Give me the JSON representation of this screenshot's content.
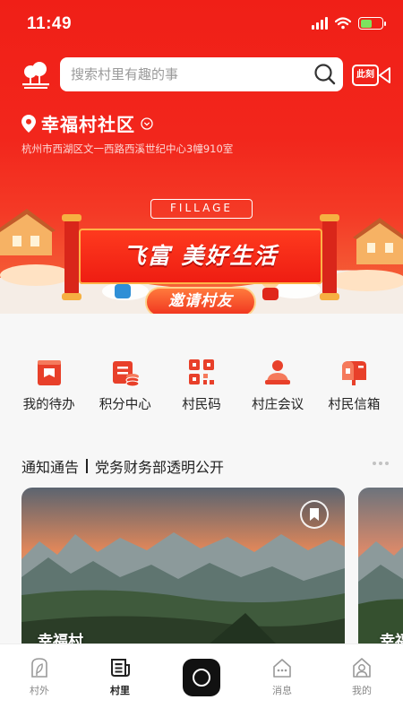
{
  "status_bar": {
    "time": "11:49"
  },
  "search": {
    "placeholder": "搜索村里有趣的事"
  },
  "live": {
    "label": "此刻"
  },
  "community": {
    "name": "幸福村社区",
    "address": "杭州市西湖区文一西路西溪世纪中心3幢910室"
  },
  "banner": {
    "tag": "FILLAGE",
    "slogan": "飞富 美好生活",
    "invite_label": "邀请村友"
  },
  "quick_menu": [
    {
      "label": "我的待办",
      "icon": "inbox-icon"
    },
    {
      "label": "积分中心",
      "icon": "points-icon"
    },
    {
      "label": "村民码",
      "icon": "qrcode-icon"
    },
    {
      "label": "村庄会议",
      "icon": "meeting-icon"
    },
    {
      "label": "村民信箱",
      "icon": "mailbox-icon"
    }
  ],
  "notice": {
    "title": "通知通告",
    "text": "党务财务部透明公开"
  },
  "cards": [
    {
      "label": "幸福村"
    },
    {
      "label": "幸福"
    }
  ],
  "tab_bar": {
    "items": [
      {
        "label": "村外"
      },
      {
        "label": "村里"
      },
      {
        "label": "消息"
      },
      {
        "label": "我的"
      }
    ],
    "active": "村里"
  },
  "colors": {
    "brand_red": "#f01f17",
    "icon_red": "#e8402a"
  }
}
